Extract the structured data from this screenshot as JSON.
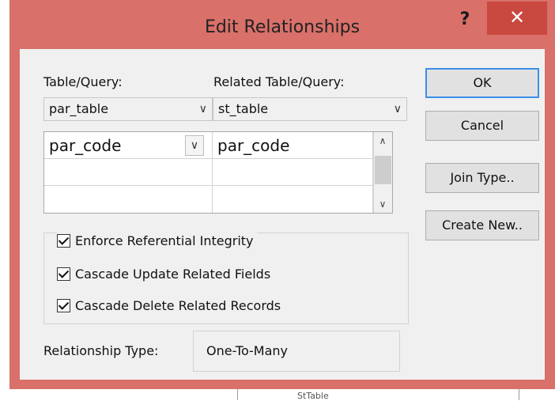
{
  "dialog": {
    "title": "Edit Relationships",
    "help_symbol": "?",
    "close_symbol": "✕"
  },
  "labels": {
    "table_query": "Table/Query:",
    "related_table_query": "Related Table/Query:",
    "relationship_type": "Relationship Type:"
  },
  "table_combo": {
    "value": "par_table",
    "arrow": "∨"
  },
  "related_combo": {
    "value": "st_table",
    "arrow": "∨"
  },
  "fields_grid": {
    "rows": [
      {
        "left": "par_code",
        "right": "par_code"
      },
      {
        "left": "",
        "right": ""
      },
      {
        "left": "",
        "right": ""
      }
    ],
    "dropdown_arrow": "∨",
    "scroll_up": "∧",
    "scroll_down": "∨"
  },
  "options": {
    "enforce_integrity": {
      "label": "Enforce Referential Integrity",
      "checked": true
    },
    "cascade_update": {
      "label": "Cascade Update Related Fields",
      "checked": true
    },
    "cascade_delete": {
      "label": "Cascade Delete Related Records",
      "checked": true
    }
  },
  "relationship_type_value": "One-To-Many",
  "buttons": {
    "ok": "OK",
    "cancel": "Cancel",
    "join_type": "Join Type..",
    "create_new": "Create New.."
  },
  "colors": {
    "title_bar": "#d9706a",
    "close_button": "#c9483f",
    "client_bg": "#f0f0f0",
    "default_button_border": "#3c8ee8"
  },
  "background_fragments": {
    "top_left": "1",
    "bottom": "StTable"
  }
}
